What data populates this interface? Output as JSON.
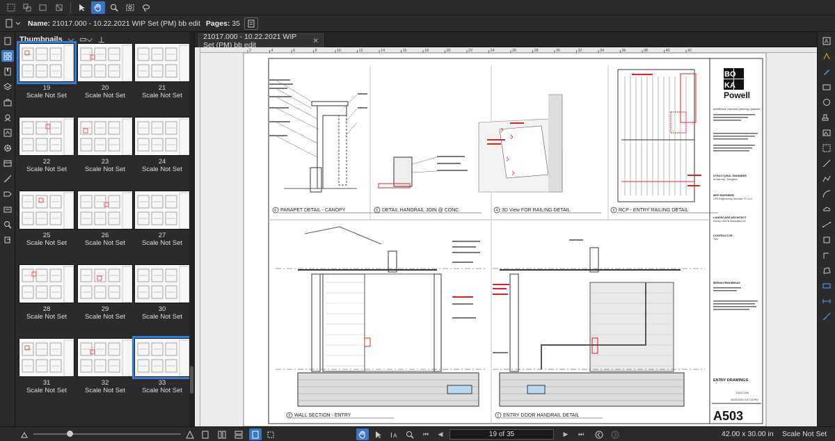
{
  "toolbar": {
    "icons": [
      "select-page-icon",
      "group-icon",
      "group2-icon",
      "group3-icon",
      "select-arrow-icon",
      "pan-hand-icon",
      "zoom-icon",
      "snapshot-icon",
      "lasso-icon"
    ]
  },
  "docbar": {
    "name_label": "Name:",
    "name_value": "21017.000 - 10.22.2021 WIP Set (PM) bb edit",
    "pages_label": "Pages:",
    "pages_value": "35"
  },
  "panel": {
    "title": "Thumbnails",
    "thumbnails": [
      {
        "num": "19",
        "scale": "Scale Not Set"
      },
      {
        "num": "20",
        "scale": "Scale Not Set"
      },
      {
        "num": "21",
        "scale": "Scale Not Set"
      },
      {
        "num": "22",
        "scale": "Scale Not Set"
      },
      {
        "num": "23",
        "scale": "Scale Not Set"
      },
      {
        "num": "24",
        "scale": "Scale Not Set"
      },
      {
        "num": "25",
        "scale": "Scale Not Set"
      },
      {
        "num": "26",
        "scale": "Scale Not Set"
      },
      {
        "num": "27",
        "scale": "Scale Not Set"
      },
      {
        "num": "28",
        "scale": "Scale Not Set"
      },
      {
        "num": "29",
        "scale": "Scale Not Set"
      },
      {
        "num": "30",
        "scale": "Scale Not Set"
      },
      {
        "num": "31",
        "scale": "Scale Not Set"
      },
      {
        "num": "32",
        "scale": "Scale Not Set"
      },
      {
        "num": "33",
        "scale": "Scale Not Set"
      }
    ]
  },
  "tab": {
    "title": "21017.000 - 10.22.2021 WIP Set (PM) bb edit"
  },
  "ruler": {
    "numbers": [
      "2",
      "4",
      "6",
      "8",
      "10",
      "12",
      "14",
      "16",
      "18",
      "20",
      "22",
      "24",
      "26",
      "28",
      "30",
      "32",
      "34",
      "36",
      "38",
      "40",
      "42"
    ]
  },
  "sheet": {
    "details": [
      {
        "num": "6",
        "title": "PARAPET DETAIL - CANOPY"
      },
      {
        "num": "5",
        "title": "DETAIL HANDRAIL JOIN @ CONC."
      },
      {
        "num": "4",
        "title": "3D View FOR RAILING DETAIL"
      },
      {
        "num": "3",
        "title": "RCP - ENTRY RAILING DETAIL"
      },
      {
        "num": "2",
        "title": "WALL SECTION - ENTRY"
      },
      {
        "num": "1",
        "title": "ENTRY DOOR HANDRAIL DETAIL"
      }
    ],
    "logo_lines": [
      "BO",
      "KA",
      "Powell"
    ],
    "firm_tagline": "architecture | interiors | planning | graphics",
    "consultants": [
      {
        "role": "STRUCTURAL ENGINEER",
        "name": "Armstrong - Douglass"
      },
      {
        "role": "MEP ENGINEER",
        "name": "CES Engineering Services TX, LLC"
      },
      {
        "role": "LANDSCAPE ARCHITECT",
        "name": "Kimley-Horn & Associates Inc"
      },
      {
        "role": "CONTRACTOR",
        "name": "TBD"
      }
    ],
    "project": "Nelson Residence",
    "sheet_title": "ENTRY DRAWINGS",
    "project_no": "21017.000",
    "date": "10/22/2021 5:57:24 PM",
    "sheet_number": "A503"
  },
  "status": {
    "page_indicator": "19 of 35",
    "dimensions": "42.00 x 30.00 in",
    "scale": "Scale Not Set"
  },
  "colors": {
    "accent": "#3a74c4",
    "red_markup": "#e02020"
  }
}
